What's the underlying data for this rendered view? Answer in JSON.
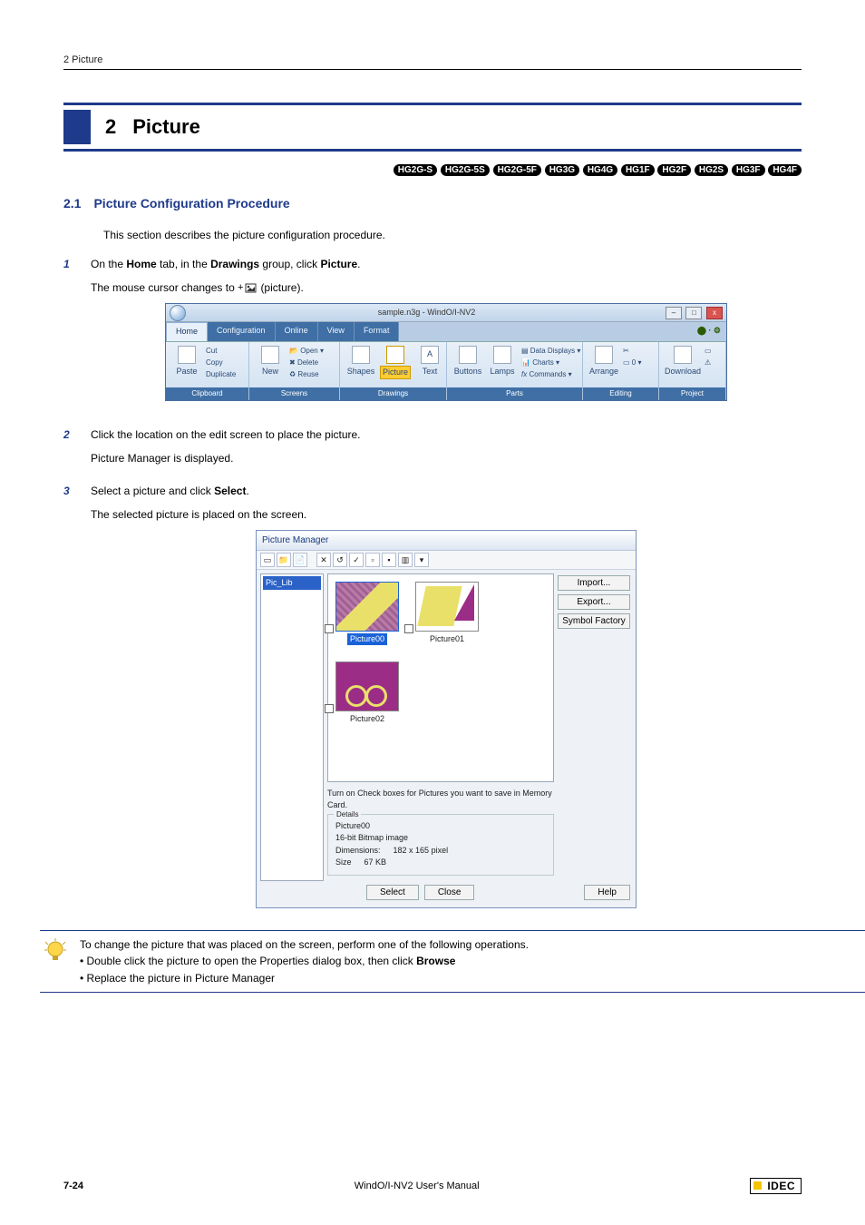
{
  "running_head": "2 Picture",
  "section": {
    "number": "2",
    "title": "Picture"
  },
  "models": [
    "HG2G-S",
    "HG2G-5S",
    "HG2G-5F",
    "HG3G",
    "HG4G",
    "HG1F",
    "HG2F",
    "HG2S",
    "HG3F",
    "HG4F"
  ],
  "subsection": {
    "number": "2.1",
    "title": "Picture Configuration Procedure"
  },
  "intro": "This section describes the picture configuration procedure.",
  "steps": {
    "s1": {
      "num": "1",
      "line_pre": "On the ",
      "b1": "Home",
      "mid1": " tab, in the ",
      "b2": "Drawings",
      "mid2": " group, click ",
      "b3": "Picture",
      "post": ".",
      "sub_pre": "The mouse cursor changes to ",
      "sub_post": " (picture)."
    },
    "s2": {
      "num": "2",
      "line": "Click the location on the edit screen to place the picture.",
      "sub": "Picture Manager is displayed."
    },
    "s3": {
      "num": "3",
      "line_pre": "Select a picture and click ",
      "b1": "Select",
      "post": ".",
      "sub": "The selected picture is placed on the screen."
    }
  },
  "ribbon": {
    "title": "sample.n3g - WindO/I-NV2",
    "tabs": [
      "Home",
      "Configuration",
      "Online",
      "View",
      "Format"
    ],
    "clipboard": {
      "paste": "Paste",
      "cut": "Cut",
      "copy": "Copy",
      "dup": "Duplicate",
      "label": "Clipboard"
    },
    "screens": {
      "new": "New",
      "open": "Open",
      "delete": "Delete",
      "reuse": "Reuse",
      "label": "Screens"
    },
    "drawings": {
      "shapes": "Shapes",
      "picture": "Picture",
      "text": "Text",
      "a": "A",
      "label": "Drawings"
    },
    "parts": {
      "buttons": "Buttons",
      "lamps": "Lamps",
      "dd": "Data Displays",
      "charts": "Charts",
      "cmd": "Commands",
      "label": "Parts"
    },
    "editing": {
      "arrange": "Arrange",
      "zero": "0",
      "label": "Editing"
    },
    "project": {
      "download": "Download",
      "label": "Project"
    }
  },
  "pm": {
    "title": "Picture Manager",
    "tree_root": "Pic_Lib",
    "thumbs": [
      "Picture00",
      "Picture01",
      "Picture02"
    ],
    "side": {
      "import": "Import...",
      "export": "Export...",
      "symbol": "Symbol Factory"
    },
    "note": "Turn on Check boxes for Pictures you want to save in Memory Card.",
    "details": {
      "legend": "Details",
      "name": "Picture00",
      "type": "16-bit Bitmap image",
      "dim_label": "Dimensions:",
      "dim": "182 x 165 pixel",
      "size_label": "Size",
      "size": "67 KB"
    },
    "buttons": {
      "select": "Select",
      "close": "Close",
      "help": "Help"
    }
  },
  "tip": {
    "lead": "To change the picture that was placed on the screen, perform one of the following operations.",
    "b1_pre": "Double click the picture to open the Properties dialog box, then click ",
    "b1_bold": "Browse",
    "b2": "Replace the picture in Picture Manager"
  },
  "footer": {
    "page": "7-24",
    "center": "WindO/I-NV2 User's Manual",
    "brand": "IDEC"
  }
}
